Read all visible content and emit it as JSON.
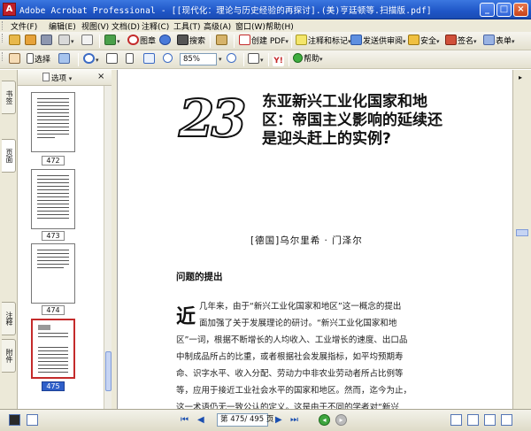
{
  "window": {
    "app_icon": "acrobat-icon",
    "title": "Adobe Acrobat Professional - [[现代化：理论与历史经验的再探讨].(美)亨廷顿等.扫描版.pdf]",
    "buttons": {
      "minimize": "_",
      "maximize": "□",
      "close": "×"
    }
  },
  "menu": {
    "items": [
      "文件(F)",
      "编辑(E)",
      "视图(V)",
      "文档(D)",
      "注释(C)",
      "工具(T)",
      "高级(A)",
      "窗口(W)",
      "帮助(H)"
    ]
  },
  "toolbar1": {
    "find_label": "搜索",
    "create_pdf_label": "创建 PDF",
    "comment_label": "注释和标记",
    "send_review_label": "发送供审阅",
    "secure_label": "安全",
    "sign_label": "签名",
    "forms_label": "表单",
    "print_label": "图章"
  },
  "toolbar2": {
    "select_label": "选择",
    "zoom_value": "85%",
    "help_label": "帮助"
  },
  "nav_tabs": [
    "书签",
    "页面",
    "注释",
    "附件"
  ],
  "pages_panel": {
    "options_label": "选项",
    "close_label": "×",
    "thumbnails": [
      {
        "label": "472",
        "selected": false
      },
      {
        "label": "473",
        "selected": false
      },
      {
        "label": "474",
        "selected": false
      },
      {
        "label": "475",
        "selected": true
      }
    ]
  },
  "document": {
    "chapter_number": "23",
    "chapter_title": "东亚新兴工业化国家和地区：帝国主义影响的延续还是迎头赶上的实例?",
    "author": "[德国]乌尔里希 · 门泽尔",
    "section_heading": "问题的提出",
    "drop_cap": "近",
    "lines": [
      "几年来，由于“新兴工业化国家和地区”这一概念的提出",
      "面加强了关于发展理论的研讨。“新兴工业化国家和地",
      "区”一词，根据不断增长的人均收入、工业增长的速度、出口品",
      "中制成品所占的比重，或者根据社会发展指标，如平均预期寿",
      "命、识字水平、收入分配、劳动力中非农业劳动者所占比例等",
      "等，应用于接近工业社会水平的国家和地区。然而，迄今为止，",
      "这一术语仍无一致公认的定义。这是由于不同的学者对“新兴"
    ]
  },
  "statusbar": {
    "page_display": "第 475/ 495 页"
  }
}
